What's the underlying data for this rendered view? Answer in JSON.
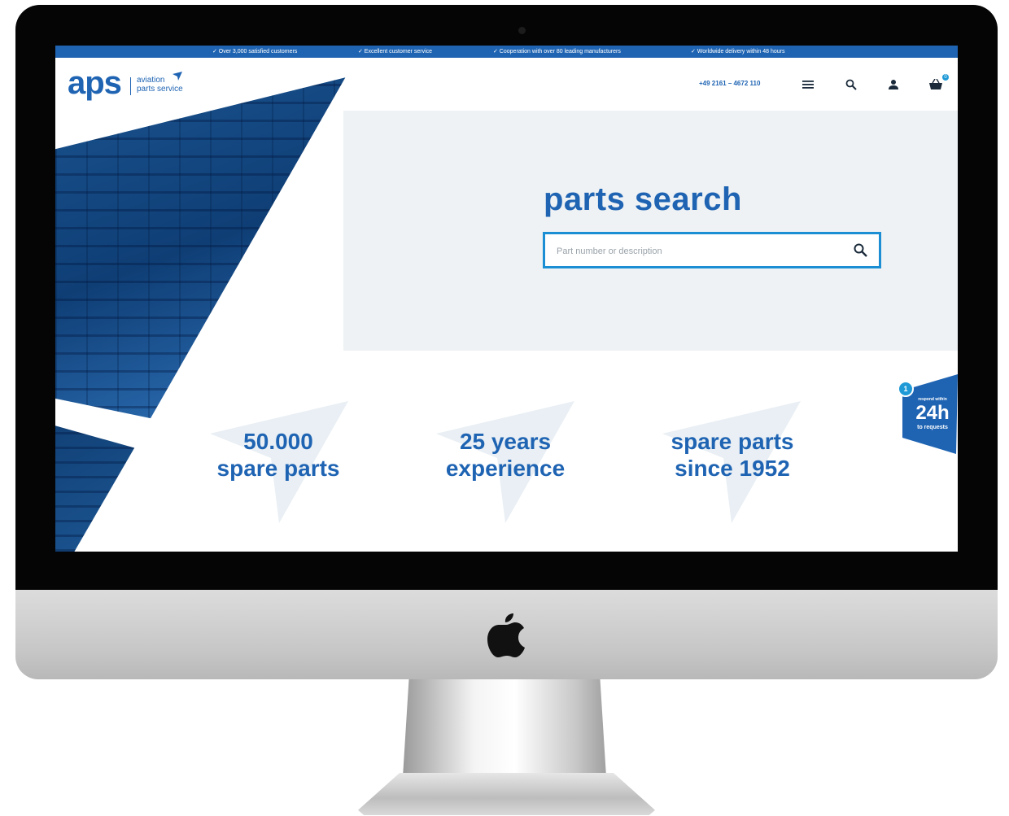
{
  "topbar": {
    "items": [
      "✓ Over 3,000 satisfied customers",
      "✓ Excellent customer service",
      "✓ Cooperation with over 80 leading manufacturers",
      "✓ Worldwide delivery within 48 hours"
    ]
  },
  "logo": {
    "brand": "aps",
    "line1": "aviation",
    "line2": "parts service"
  },
  "header": {
    "phone": "+49 2161 – 4672 110",
    "cart_count": "0",
    "icons": [
      "menu-icon",
      "search-icon",
      "user-icon",
      "basket-icon"
    ]
  },
  "search": {
    "title": "parts search",
    "placeholder": "Part number or description"
  },
  "stats": [
    {
      "line1": "50.000",
      "line2": "spare parts"
    },
    {
      "line1": "25 years",
      "line2": "experience"
    },
    {
      "line1": "spare parts",
      "line2": "since 1952"
    }
  ],
  "badge": {
    "number": "1",
    "top": "respond within",
    "big": "24h",
    "bottom": "to requests"
  },
  "colors": {
    "brand_blue": "#1f64b3",
    "accent_blue": "#1c8fd4",
    "panel_gray": "#eef2f4"
  }
}
